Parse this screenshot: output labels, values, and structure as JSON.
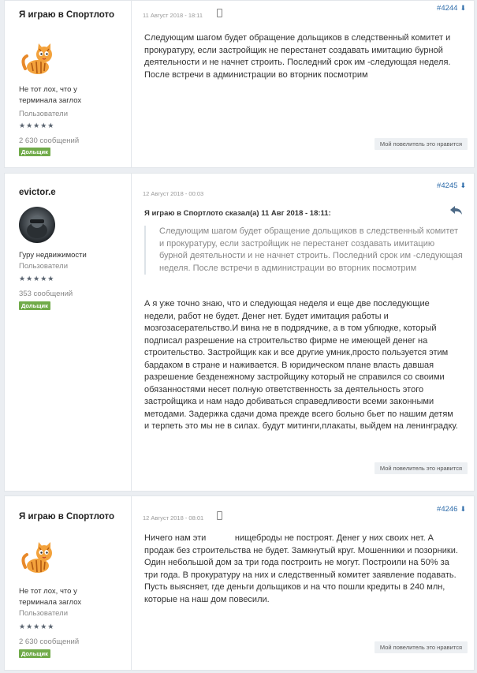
{
  "posts": [
    {
      "author": "Я играю в Спортлото",
      "avatar": "tiger-cat-icon",
      "rank": "Не тот лох, что у терминала заглох",
      "group": "Пользователи",
      "stars": "★★★★★",
      "messages": "2 630 сообщений",
      "badge": "Дольщик",
      "date": "11 Август 2018 - 18:11",
      "device": "mobile-icon",
      "number": "#4244",
      "text": "Следующим шагом будет обращение дольщиков в следственный комитет и прокуратуру, если застройщик не перестанет создавать имитацию бурной деятельности и не начнет строить. Последний срок им -следующая неделя. После встречи в администрации во вторник посмотрим",
      "like": "Мой повелитель это нравится"
    },
    {
      "author": "evictor.e",
      "avatar": "photo-avatar",
      "rank": "Гуру недвижимости",
      "group": "Пользователи",
      "stars": "★★★★★",
      "messages": "353 сообщений",
      "badge": "Дольщик",
      "date": "12 Август 2018 - 00:03",
      "number": "#4245",
      "quote_header": "Я играю в Спортлото сказал(а) 11 Авг 2018 - 18:11:",
      "quote_text": "Следующим шагом будет обращение дольщиков в следственный комитет и прокуратуру, если застройщик не перестанет создавать имитацию бурной деятельности и не начнет строить. Последний срок им -следующая неделя. После встречи в администрации во вторник посмотрим",
      "text": "А я уже точно знаю, что и следующая неделя и еще две последующие недели, работ не будет. Денег нет. Будет имитация работы и мозгозасерательство.И вина не в подрядчике, а в том ублюдке, который подписал разрешение на строительство фирме не имеющей денег на строительство. Застройщик как и все другие умник,просто пользуется этим бардаком в стране и наживается. В юридическом плане власть давшая разрешение безденежному застройщику который не справился со своими обязанностями несет полную ответственность за деятельность этого застройщика и нам надо добиваться справедливости всеми законными методами. Задержка сдачи дома прежде всего больно бьет по нашим детям и терпеть это мы не в силах. будут митинги,плакаты, выйдем на ленинградку.",
      "like": "Мой повелитель это нравится"
    },
    {
      "author": "Я играю в Спортлото",
      "avatar": "tiger-cat-icon",
      "rank": "Не тот лох, что у терминала заглох",
      "group": "Пользователи",
      "stars": "★★★★★",
      "messages": "2 630 сообщений",
      "badge": "Дольщик",
      "date": "12 Август 2018 - 08:01",
      "device": "mobile-icon",
      "number": "#4246",
      "text": "Ничего нам эти            нищеброды не построят. Денег у них своих нет. А продаж без строительства не будет. Замкнутый круг. Мошенники и позорники. Один небольшой дом за три года построить не могут. Построили на 50% за три года. В прокуратуру на них и следственный комитет заявление подавать. Пусть выясняет, где деньги дольщиков и на что пошли кредиты в 240 млн, которые на наш дом повесили.",
      "like": "Мой повелитель это нравится"
    }
  ]
}
